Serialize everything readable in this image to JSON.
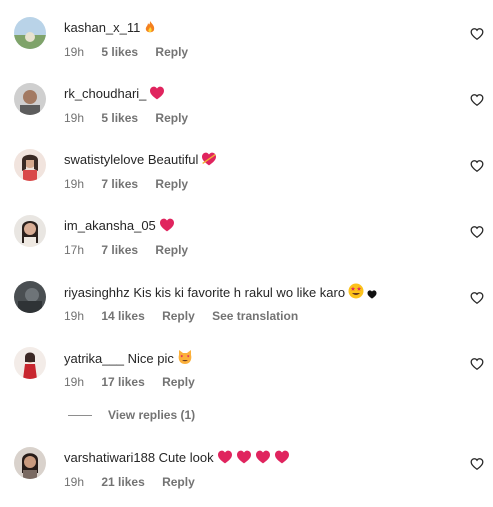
{
  "comments": [
    {
      "username": "kashan_x_11",
      "text": "",
      "emoji": [
        "fire"
      ],
      "time": "19h",
      "likes": "5 likes",
      "reply": "Reply",
      "translation": ""
    },
    {
      "username": "rk_choudhari_",
      "text": "",
      "emoji": [
        "heart"
      ],
      "time": "19h",
      "likes": "5 likes",
      "reply": "Reply",
      "translation": ""
    },
    {
      "username": "swatistylelove",
      "text": "Beautiful",
      "emoji": [
        "heart-arrow"
      ],
      "time": "19h",
      "likes": "7 likes",
      "reply": "Reply",
      "translation": ""
    },
    {
      "username": "im_akansha_05",
      "text": "",
      "emoji": [
        "heart"
      ],
      "time": "17h",
      "likes": "7 likes",
      "reply": "Reply",
      "translation": ""
    },
    {
      "username": "riyasinghhz",
      "text": "Kis kis ki favorite h rakul wo like karo",
      "emoji": [
        "star-eyes",
        "black-heart"
      ],
      "time": "19h",
      "likes": "14 likes",
      "reply": "Reply",
      "translation": "See translation"
    },
    {
      "username": "yatrika___",
      "text": "Nice pic",
      "emoji": [
        "heart-cat"
      ],
      "time": "19h",
      "likes": "17 likes",
      "reply": "Reply",
      "translation": ""
    },
    {
      "username": "varshatiwari188",
      "text": "Cute look",
      "emoji": [
        "heart",
        "heart",
        "heart",
        "heart"
      ],
      "time": "19h",
      "likes": "21 likes",
      "reply": "Reply",
      "translation": ""
    }
  ],
  "view_replies": "View replies (1)",
  "colors": {
    "text": "#262626",
    "muted": "#737373",
    "heart": "#e0245e"
  }
}
